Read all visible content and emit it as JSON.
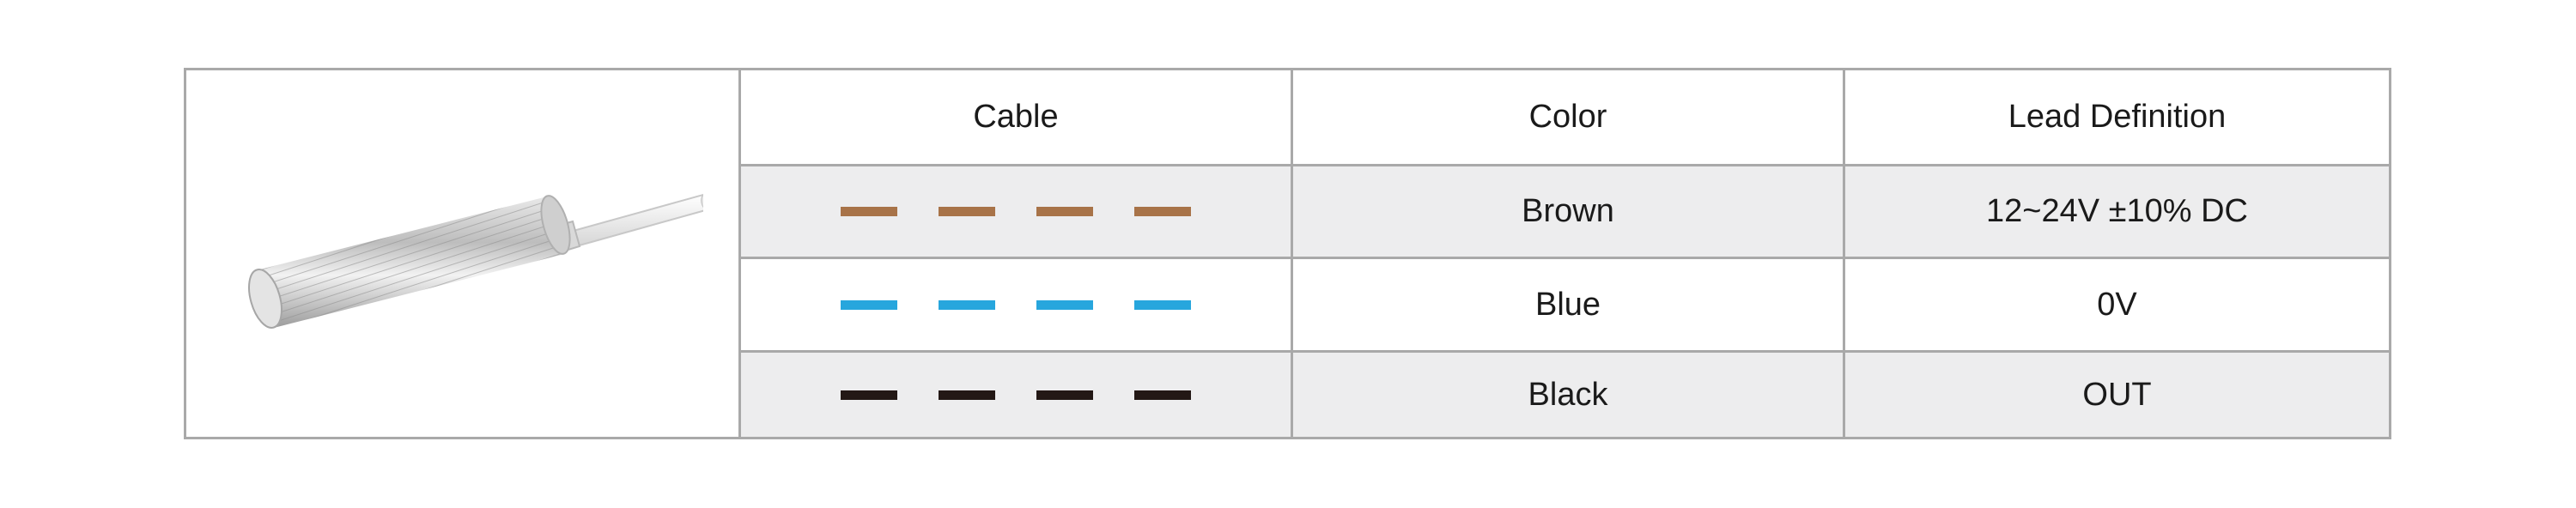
{
  "table": {
    "headers": {
      "cable": "Cable",
      "color": "Color",
      "lead_definition": "Lead Definition"
    },
    "rows": [
      {
        "color_name": "Brown",
        "lead_definition": "12~24V ±10% DC",
        "wire_color": "#a87348"
      },
      {
        "color_name": "Blue",
        "lead_definition": "0V",
        "wire_color": "#27a6dd"
      },
      {
        "color_name": "Black",
        "lead_definition": "OUT",
        "wire_color": "#231815"
      }
    ]
  },
  "product_image": {
    "icon": "cylindrical-proximity-sensor-icon"
  }
}
